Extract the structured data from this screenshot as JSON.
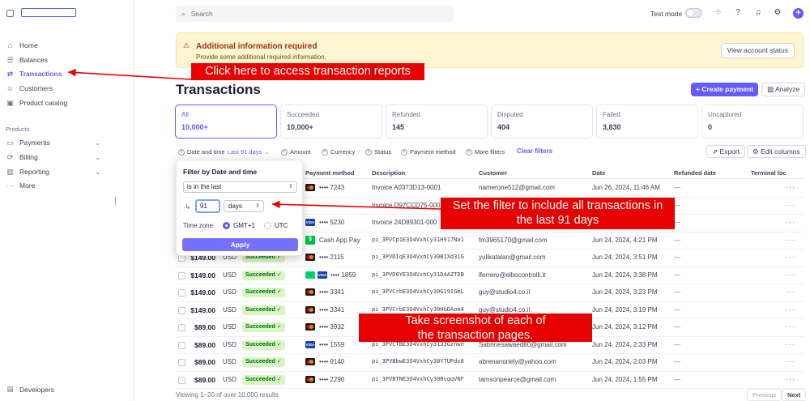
{
  "sidebar": {
    "nav": [
      {
        "label": "Home",
        "icon": "home-icon"
      },
      {
        "label": "Balances",
        "icon": "balances-icon"
      },
      {
        "label": "Transactions",
        "icon": "transactions-icon",
        "active": true
      },
      {
        "label": "Customers",
        "icon": "customers-icon"
      },
      {
        "label": "Product catalog",
        "icon": "product-catalog-icon"
      }
    ],
    "section_label": "Products",
    "products": [
      {
        "label": "Payments",
        "icon": "payments-icon"
      },
      {
        "label": "Billing",
        "icon": "billing-icon"
      },
      {
        "label": "Reporting",
        "icon": "reporting-icon"
      },
      {
        "label": "More",
        "icon": "more-icon"
      }
    ],
    "developers": "Developers"
  },
  "topbar": {
    "search_placeholder": "Search",
    "test_mode": "Test mode"
  },
  "banner": {
    "title": "Additional information required",
    "subtitle": "Provide some additional required information.",
    "button": "View account status"
  },
  "page": {
    "title": "Transactions",
    "create_payment": "+ Create payment",
    "analyze": "Analyze"
  },
  "tiles": [
    {
      "label": "All",
      "value": "10,000+",
      "selected": true
    },
    {
      "label": "Succeeded",
      "value": "10,000+"
    },
    {
      "label": "Refunded",
      "value": "145"
    },
    {
      "label": "Disputed",
      "value": "404"
    },
    {
      "label": "Failed",
      "value": "3,830"
    },
    {
      "label": "Uncaptured",
      "value": "0"
    }
  ],
  "filters": {
    "date_label": "Date and time",
    "date_value": "Last 91 days",
    "amount": "Amount",
    "currency": "Currency",
    "status": "Status",
    "payment_method": "Payment method",
    "more": "More filters",
    "clear": "Clear filters",
    "export": "Export",
    "edit_columns": "Edit columns"
  },
  "table": {
    "headers": {
      "payment_method": "Payment method",
      "description": "Description",
      "customer": "Customer",
      "date": "Date",
      "refunded_date": "Refunded date",
      "terminal": "Terminal loc"
    },
    "rows": [
      {
        "amount": "",
        "currency": "",
        "status": "",
        "pm": "mc",
        "pm_text": "•••• 7243",
        "desc": "Invoice A0373D13-0001",
        "mono": false,
        "customer": "namerone512@gmail.com",
        "date": "Jun 26, 2024, 11:46 AM",
        "refund": "—"
      },
      {
        "amount": "",
        "currency": "",
        "status": "",
        "pm": "",
        "pm_text": "",
        "desc": "Invoice D97CCD75-000",
        "mono": false,
        "customer": "",
        "date": "",
        "refund": "—"
      },
      {
        "amount": "",
        "currency": "",
        "status": "",
        "pm": "visa",
        "pm_text": "•••• 5230",
        "desc": "Invoice 24D89301-000",
        "mono": false,
        "customer": "",
        "date": "",
        "refund": "—"
      },
      {
        "amount": "",
        "currency": "",
        "status": "",
        "pm": "cash",
        "pm_text": "Cash App Pay",
        "desc": "pi_3PVCp1E3O4VxhCy31H917Na1",
        "mono": true,
        "customer": "fm3965170@gmail.com",
        "date": "Jun 24, 2024, 4:21 PM",
        "refund": "—"
      },
      {
        "amount": "$149.00",
        "currency": "USD",
        "status": "Succeeded ✓",
        "pm": "mc",
        "pm_text": "•••• 2115",
        "desc": "pi_3PVDIqE3O4VxhCy30B1Xd31G",
        "mono": true,
        "customer": "yulikatalan@gmail.com",
        "date": "Jun 24, 2024, 3:51 PM",
        "refund": "—"
      },
      {
        "amount": "$149.00",
        "currency": "USD",
        "status": "Succeeded ✓",
        "pm": "link",
        "pm_text": "•••• 1859",
        "desc": "pi_3PVD6YE3O4VxhCy31D4AZTDB",
        "mono": true,
        "customer": "lferrero@elbocontrolli.it",
        "date": "Jun 24, 2024, 3:38 PM",
        "refund": "—"
      },
      {
        "amount": "$149.00",
        "currency": "USD",
        "status": "Succeeded ✓",
        "pm": "mc",
        "pm_text": "•••• 3341",
        "desc": "pi_3PVCrbE3O4VxhCy30G19IGmL",
        "mono": true,
        "customer": "guy@studio4.co.il",
        "date": "Jun 24, 2024, 3:23 PM",
        "refund": "—"
      },
      {
        "amount": "$149.00",
        "currency": "USD",
        "status": "Succeeded ✓",
        "pm": "mc",
        "pm_text": "•••• 3341",
        "desc": "pi_3PVCrbE3O4VxhCy30HbDAom4",
        "mono": true,
        "customer": "guy@studio4.co.il",
        "date": "Jun 24, 2024, 3:19 PM",
        "refund": "—"
      },
      {
        "amount": "$89.00",
        "currency": "USD",
        "status": "Succeeded ✓",
        "pm": "mc",
        "pm_text": "•••• 3932",
        "desc": "",
        "mono": true,
        "customer": "",
        "date": "Jun 24, 2024, 3:12 PM",
        "refund": "—"
      },
      {
        "amount": "$89.00",
        "currency": "USD",
        "status": "Succeeded ✓",
        "pm": "visa",
        "pm_text": "•••• 1559",
        "desc": "pi_3PVCTBE3O4VxhCy3133Gznwn",
        "mono": true,
        "customer": "Sabrinesawaed80@gmail.com",
        "date": "Jun 24, 2024, 2:33 PM",
        "refund": "—"
      },
      {
        "amount": "$89.00",
        "currency": "USD",
        "status": "Succeeded ✓",
        "pm": "mc",
        "pm_text": "•••• 9140",
        "desc": "pi_3PVBbwE3O4VxhCy30Y7UPds8",
        "mono": true,
        "customer": "abrenanoriely@yahoo.com",
        "date": "Jun 24, 2024, 2:03 PM",
        "refund": "—"
      },
      {
        "amount": "$89.00",
        "currency": "USD",
        "status": "Succeeded ✓",
        "pm": "mc",
        "pm_text": "•••• 2290",
        "desc": "pi_3PVBTNE3O4VxhCy30BvqqVNF",
        "mono": true,
        "customer": "tamsonpearce@gmail.com",
        "date": "Jun 24, 2024, 1:55 PM",
        "refund": "—"
      }
    ]
  },
  "footer": {
    "count": "Viewing 1–20 of over 10,000 results",
    "previous": "Previous",
    "next": "Next"
  },
  "popup": {
    "title": "Filter by Date and time",
    "condition": "is in the last",
    "number": "91",
    "unit": "days",
    "timezone_label": "Time zone:",
    "tz_gmt": "GMT+1",
    "tz_utc": "UTC",
    "apply": "Apply"
  },
  "annotations": {
    "click_here": "Click here to access transaction reports",
    "set_filter": "Set the filter to include all transactions in the last 91 days",
    "screenshot": "Take screenshot of each of the transaction pages."
  },
  "colors": {
    "accent": "#635bff",
    "annotation": "#e60000",
    "banner_bg": "#fcf5cf",
    "success_bg": "#d7f7c2"
  }
}
